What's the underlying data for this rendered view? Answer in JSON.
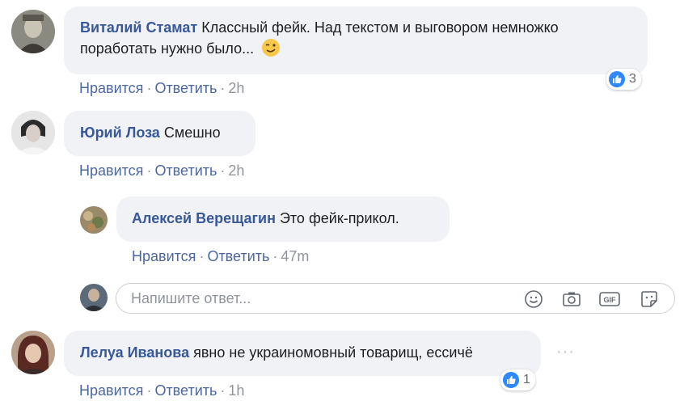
{
  "colors": {
    "author": "#385898",
    "bubble": "#f0f2f5",
    "link": "#4b67a1",
    "meta": "#90949c",
    "like": "#2e89ff"
  },
  "comments": [
    {
      "author": "Виталий Стамат",
      "text_line1": "Классный фейк. Над текстом и выговором немножко",
      "text_line2": "поработать нужно было...",
      "emoji": "wink-emoji",
      "like_label": "Нравится",
      "reply_label": "Ответить",
      "time": "2h",
      "reactions": "3"
    },
    {
      "author": "Юрий Лоза",
      "text": "Смешно",
      "like_label": "Нравится",
      "reply_label": "Ответить",
      "time": "2h"
    },
    {
      "author": "Алексей Верещагин",
      "text": "Это фейк-прикол.",
      "like_label": "Нравится",
      "reply_label": "Ответить",
      "time": "47m"
    },
    {
      "author": "Лелуа Иванова",
      "text": "явно не украиномовный товарищ, ессичё",
      "like_label": "Нравится",
      "reply_label": "Ответить",
      "time": "1h",
      "reactions": "1"
    }
  ],
  "reply_box": {
    "placeholder": "Напишите ответ...",
    "icons": [
      "emoji-icon",
      "camera-icon",
      "gif-icon",
      "sticker-icon"
    ]
  },
  "separator": "·",
  "more_icon": "···"
}
